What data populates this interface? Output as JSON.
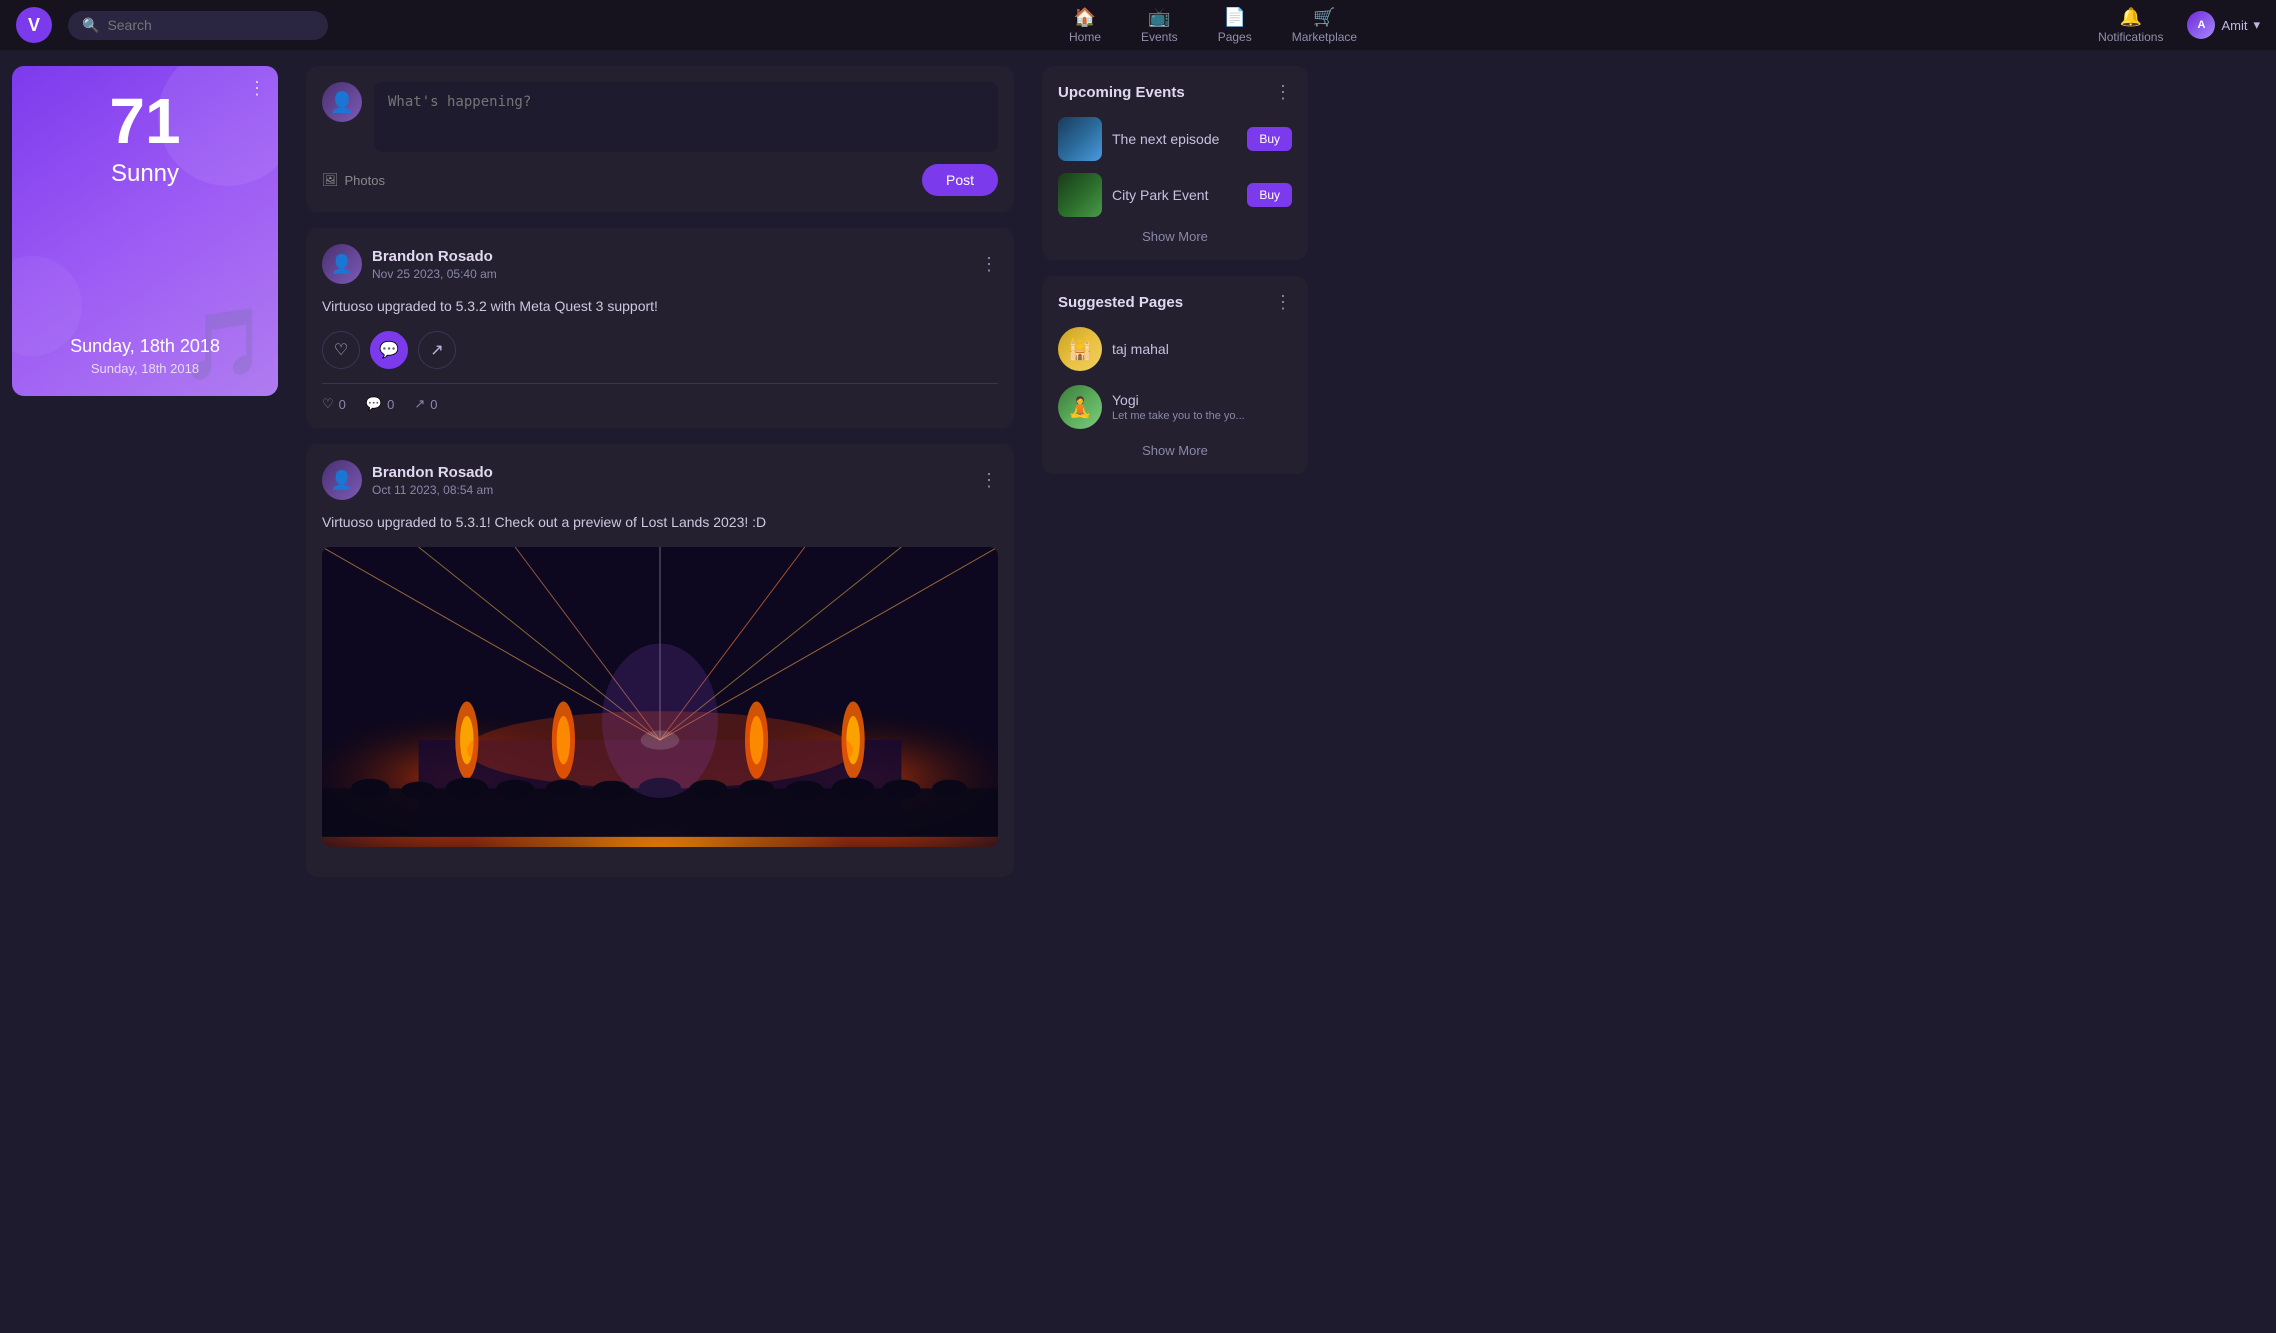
{
  "navbar": {
    "logo": "V",
    "search_placeholder": "Search",
    "nav_items": [
      {
        "id": "home",
        "label": "Home",
        "icon": "🏠"
      },
      {
        "id": "events",
        "label": "Events",
        "icon": "📺"
      },
      {
        "id": "pages",
        "label": "Pages",
        "icon": "📄"
      },
      {
        "id": "marketplace",
        "label": "Marketplace",
        "icon": "🛒"
      }
    ],
    "notifications_label": "Notifications",
    "notifications_icon": "🔔",
    "user_label": "Amit",
    "user_initials": "A"
  },
  "weather": {
    "temperature": "71",
    "condition": "Sunny",
    "date_main": "Sunday, 18th 2018",
    "date_sub": "Sunday, 18th 2018",
    "dots": "⋮"
  },
  "post_box": {
    "placeholder": "What's happening?",
    "photos_label": "Photos",
    "post_label": "Post"
  },
  "feed": [
    {
      "id": "post1",
      "author": "Brandon Rosado",
      "time": "Nov 25 2023, 05:40 am",
      "text": "Virtuoso upgraded to 5.3.2 with Meta Quest 3 support!",
      "has_image": false,
      "likes": 0,
      "comments": 0,
      "shares": 0
    },
    {
      "id": "post2",
      "author": "Brandon Rosado",
      "time": "Oct 11 2023, 08:54 am",
      "text": "Virtuoso upgraded to 5.3.1! Check out a preview of Lost Lands 2023! :D",
      "has_image": true,
      "likes": 0,
      "comments": 0,
      "shares": 0
    }
  ],
  "upcoming_events": {
    "title": "Upcoming Events",
    "items": [
      {
        "name": "The next episode",
        "type": "episode"
      },
      {
        "name": "City Park Event",
        "type": "park"
      }
    ],
    "show_more": "Show More",
    "buy_label": "Buy"
  },
  "suggested_pages": {
    "title": "Suggested Pages",
    "items": [
      {
        "name": "taj mahal",
        "type": "taj",
        "desc": ""
      },
      {
        "name": "Yogi",
        "type": "yogi",
        "desc": "Let me take you to the yo..."
      }
    ],
    "show_more": "Show More"
  }
}
